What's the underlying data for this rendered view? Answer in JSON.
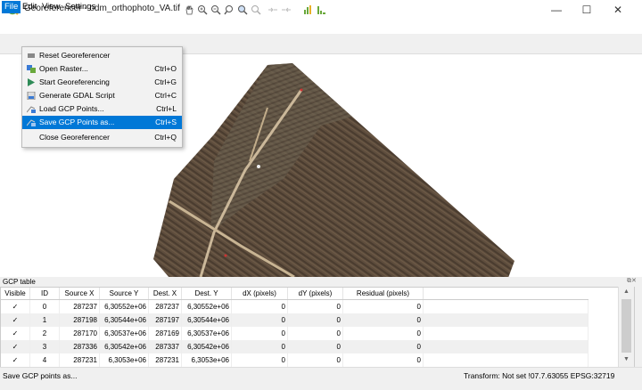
{
  "window": {
    "title": "Georeferencer - odm_orthophoto_VA.tif",
    "minimize": "—",
    "maximize": "☐",
    "close": "✕"
  },
  "menubar": [
    "File",
    "Edit",
    "View",
    "Settings"
  ],
  "file_menu": [
    {
      "label": "Reset Georeferencer",
      "shortcut": "",
      "icon": "reset-icon",
      "highlighted": false
    },
    {
      "label": "Open Raster...",
      "shortcut": "Ctrl+O",
      "icon": "open-raster-icon",
      "highlighted": false
    },
    {
      "label": "Start Georeferencing",
      "shortcut": "Ctrl+G",
      "icon": "play-icon",
      "highlighted": false
    },
    {
      "label": "Generate GDAL Script",
      "shortcut": "Ctrl+C",
      "icon": "script-icon",
      "highlighted": false
    },
    {
      "label": "Load GCP Points...",
      "shortcut": "Ctrl+L",
      "icon": "load-gcp-icon",
      "highlighted": false
    },
    {
      "label": "Save GCP Points as...",
      "shortcut": "Ctrl+S",
      "icon": "save-gcp-icon",
      "highlighted": true
    },
    {
      "label": "Close Georeferencer",
      "shortcut": "Ctrl+Q",
      "icon": "",
      "highlighted": false
    }
  ],
  "gcp": {
    "title": "GCP table",
    "columns": [
      "Visible",
      "ID",
      "Source X",
      "Source Y",
      "Dest. X",
      "Dest. Y",
      "dX (pixels)",
      "dY (pixels)",
      "Residual (pixels)"
    ],
    "rows": [
      [
        "✓",
        "0",
        "287237",
        "6,30552e+06",
        "287237",
        "6,30552e+06",
        "0",
        "0",
        "0"
      ],
      [
        "✓",
        "1",
        "287198",
        "6,30544e+06",
        "287197",
        "6,30544e+06",
        "0",
        "0",
        "0"
      ],
      [
        "✓",
        "2",
        "287170",
        "6,30537e+06",
        "287169",
        "6,30537e+06",
        "0",
        "0",
        "0"
      ],
      [
        "✓",
        "3",
        "287336",
        "6,30542e+06",
        "287337",
        "6,30542e+06",
        "0",
        "0",
        "0"
      ],
      [
        "✓",
        "4",
        "287231",
        "6,3053e+06",
        "287231",
        "6,3053e+06",
        "0",
        "0",
        "0"
      ]
    ]
  },
  "status": {
    "message": "Save GCP points as...",
    "transform": "Transform: Not set",
    "coords": "!07.7.63055",
    "crs": "EPSG:32719"
  },
  "colors": {
    "accent": "#0078d7",
    "field": "#5a4a3a",
    "qgis_green": "#69a83b"
  }
}
